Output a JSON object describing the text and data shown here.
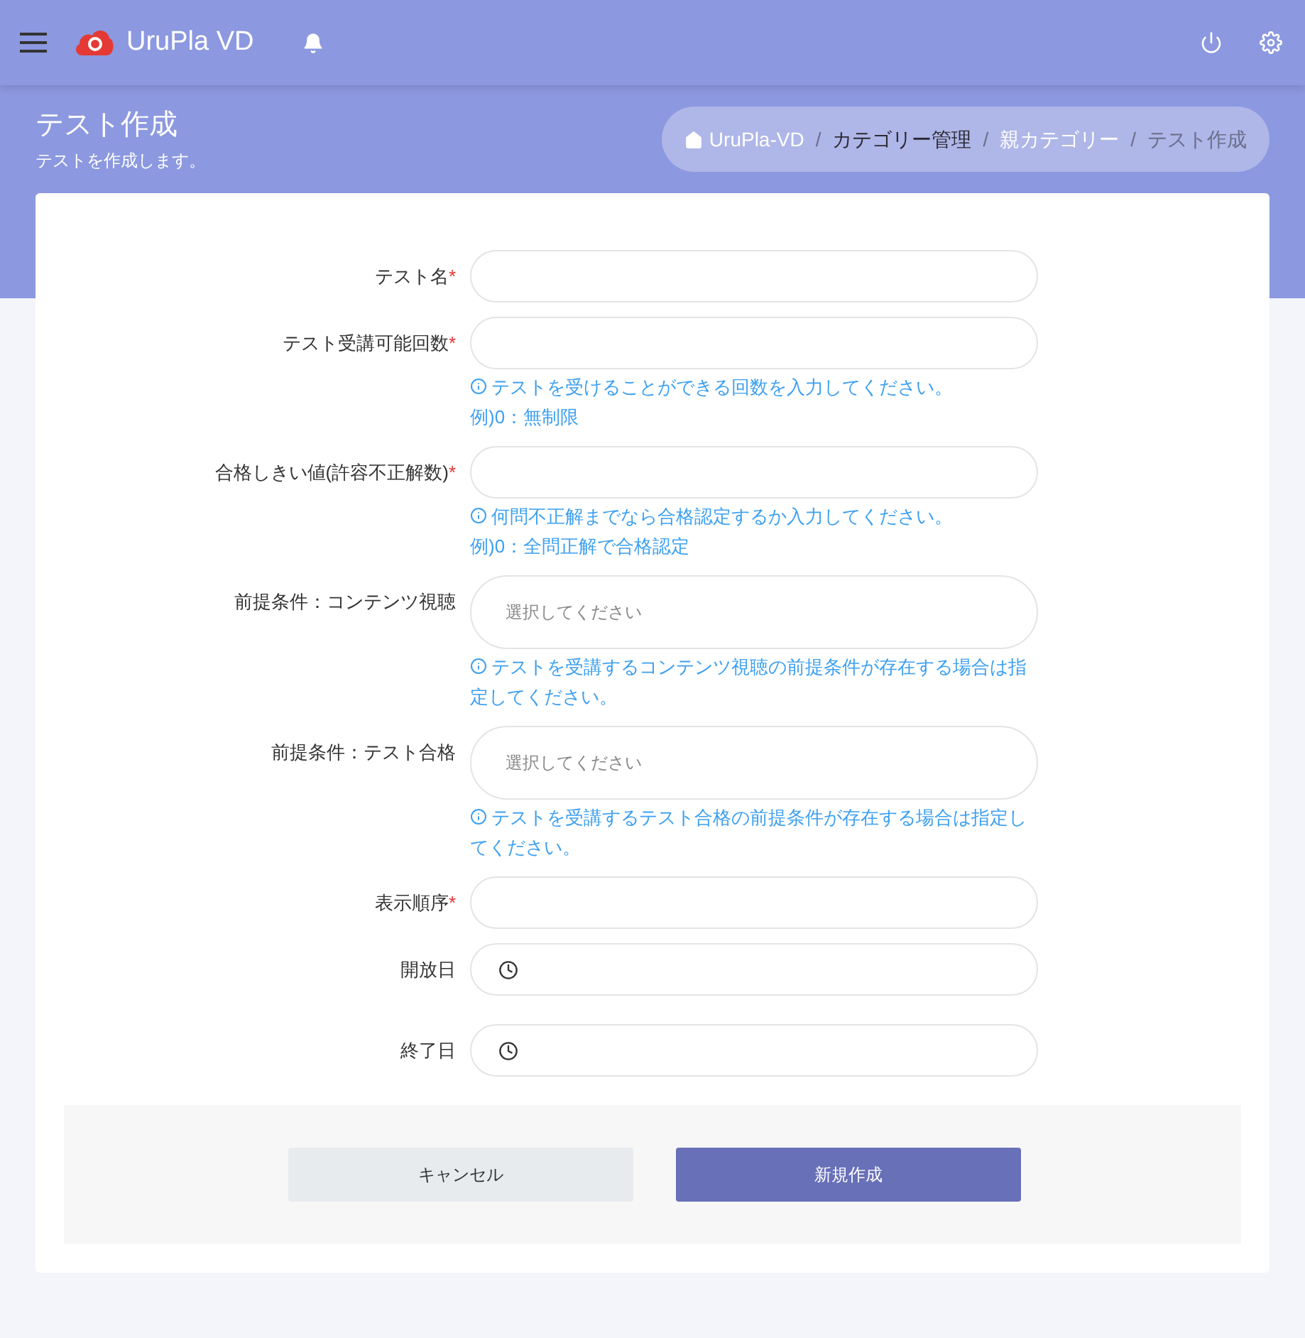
{
  "header": {
    "brand": "UruPla VD"
  },
  "page": {
    "title": "テスト作成",
    "subtitle": "テストを作成します。"
  },
  "breadcrumb": [
    {
      "label": "UruPla-VD",
      "kind": "home",
      "color": "#ffffff"
    },
    {
      "label": "/",
      "kind": "separator",
      "color": "#6b6f8a"
    },
    {
      "label": "カテゴリー管理",
      "kind": "link",
      "color": "#2b2b33"
    },
    {
      "label": "/",
      "kind": "separator",
      "color": "#6b6f8a"
    },
    {
      "label": "親カテゴリー",
      "kind": "link",
      "color": "#ffffff"
    },
    {
      "label": "/",
      "kind": "separator",
      "color": "#6b6f8a"
    },
    {
      "label": "テスト作成",
      "kind": "current",
      "color": "#6b6f8a"
    }
  ],
  "fields": [
    {
      "label": "テスト名",
      "kind": "text",
      "required": true
    },
    {
      "label": "テスト受講可能回数",
      "kind": "text",
      "required": true,
      "help": [
        "テストを受けることができる回数を入力してください。",
        "例)0：無制限"
      ]
    },
    {
      "label": "合格しきい値(許容不正解数)",
      "kind": "text",
      "required": true,
      "help": [
        "何問不正解までなら合格認定するか入力してください。",
        "例)0：全問正解で合格認定"
      ]
    },
    {
      "label": "前提条件：コンテンツ視聴",
      "kind": "select",
      "required": false,
      "placeholder": "選択してください",
      "help": [
        "テストを受講するコンテンツ視聴の前提条件が存在する場合は指定してください。"
      ]
    },
    {
      "label": "前提条件：テスト合格",
      "kind": "select",
      "required": false,
      "placeholder": "選択してください",
      "help": [
        "テストを受講するテスト合格の前提条件が存在する場合は指定してください。"
      ]
    },
    {
      "label": "表示順序",
      "kind": "text",
      "required": true
    },
    {
      "label": "開放日",
      "kind": "date",
      "required": false
    },
    {
      "label": "終了日",
      "kind": "date",
      "required": false
    }
  ],
  "required_mark": "*",
  "buttons": [
    {
      "label": "キャンセル",
      "kind": "secondary"
    },
    {
      "label": "新規作成",
      "kind": "primary"
    }
  ]
}
